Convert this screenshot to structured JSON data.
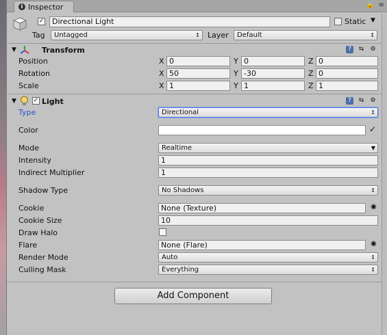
{
  "tab": {
    "label": "Inspector"
  },
  "object": {
    "name": "Directional Light",
    "static_label": "Static",
    "tag_label": "Tag",
    "tag_value": "Untagged",
    "layer_label": "Layer",
    "layer_value": "Default"
  },
  "transform": {
    "title": "Transform",
    "rows": [
      {
        "label": "Position",
        "x": "0",
        "y": "0",
        "z": "0"
      },
      {
        "label": "Rotation",
        "x": "50",
        "y": "-30",
        "z": "0"
      },
      {
        "label": "Scale",
        "x": "1",
        "y": "1",
        "z": "1"
      }
    ],
    "axis": {
      "x": "X",
      "y": "Y",
      "z": "Z"
    }
  },
  "light": {
    "title": "Light",
    "type_label": "Type",
    "type_value": "Directional",
    "color_label": "Color",
    "mode_label": "Mode",
    "mode_value": "Realtime",
    "intensity_label": "Intensity",
    "intensity_value": "1",
    "indirect_label": "Indirect Multiplier",
    "indirect_value": "1",
    "shadow_label": "Shadow Type",
    "shadow_value": "No Shadows",
    "cookie_label": "Cookie",
    "cookie_value": "None (Texture)",
    "cookie_size_label": "Cookie Size",
    "cookie_size_value": "10",
    "halo_label": "Draw Halo",
    "flare_label": "Flare",
    "flare_value": "None (Flare)",
    "render_label": "Render Mode",
    "render_value": "Auto",
    "culling_label": "Culling Mask",
    "culling_value": "Everything"
  },
  "add_component": "Add Component",
  "colors": {
    "accent_blue": "#2f52c9",
    "panel": "#c2c2c2"
  },
  "icons": [
    "info-icon",
    "lock-icon",
    "menu-icon",
    "cube-icon",
    "transform-axes-icon",
    "light-bulb-icon",
    "help-book-icon",
    "preset-icon",
    "gear-icon",
    "eyedropper-icon",
    "object-picker-icon"
  ]
}
